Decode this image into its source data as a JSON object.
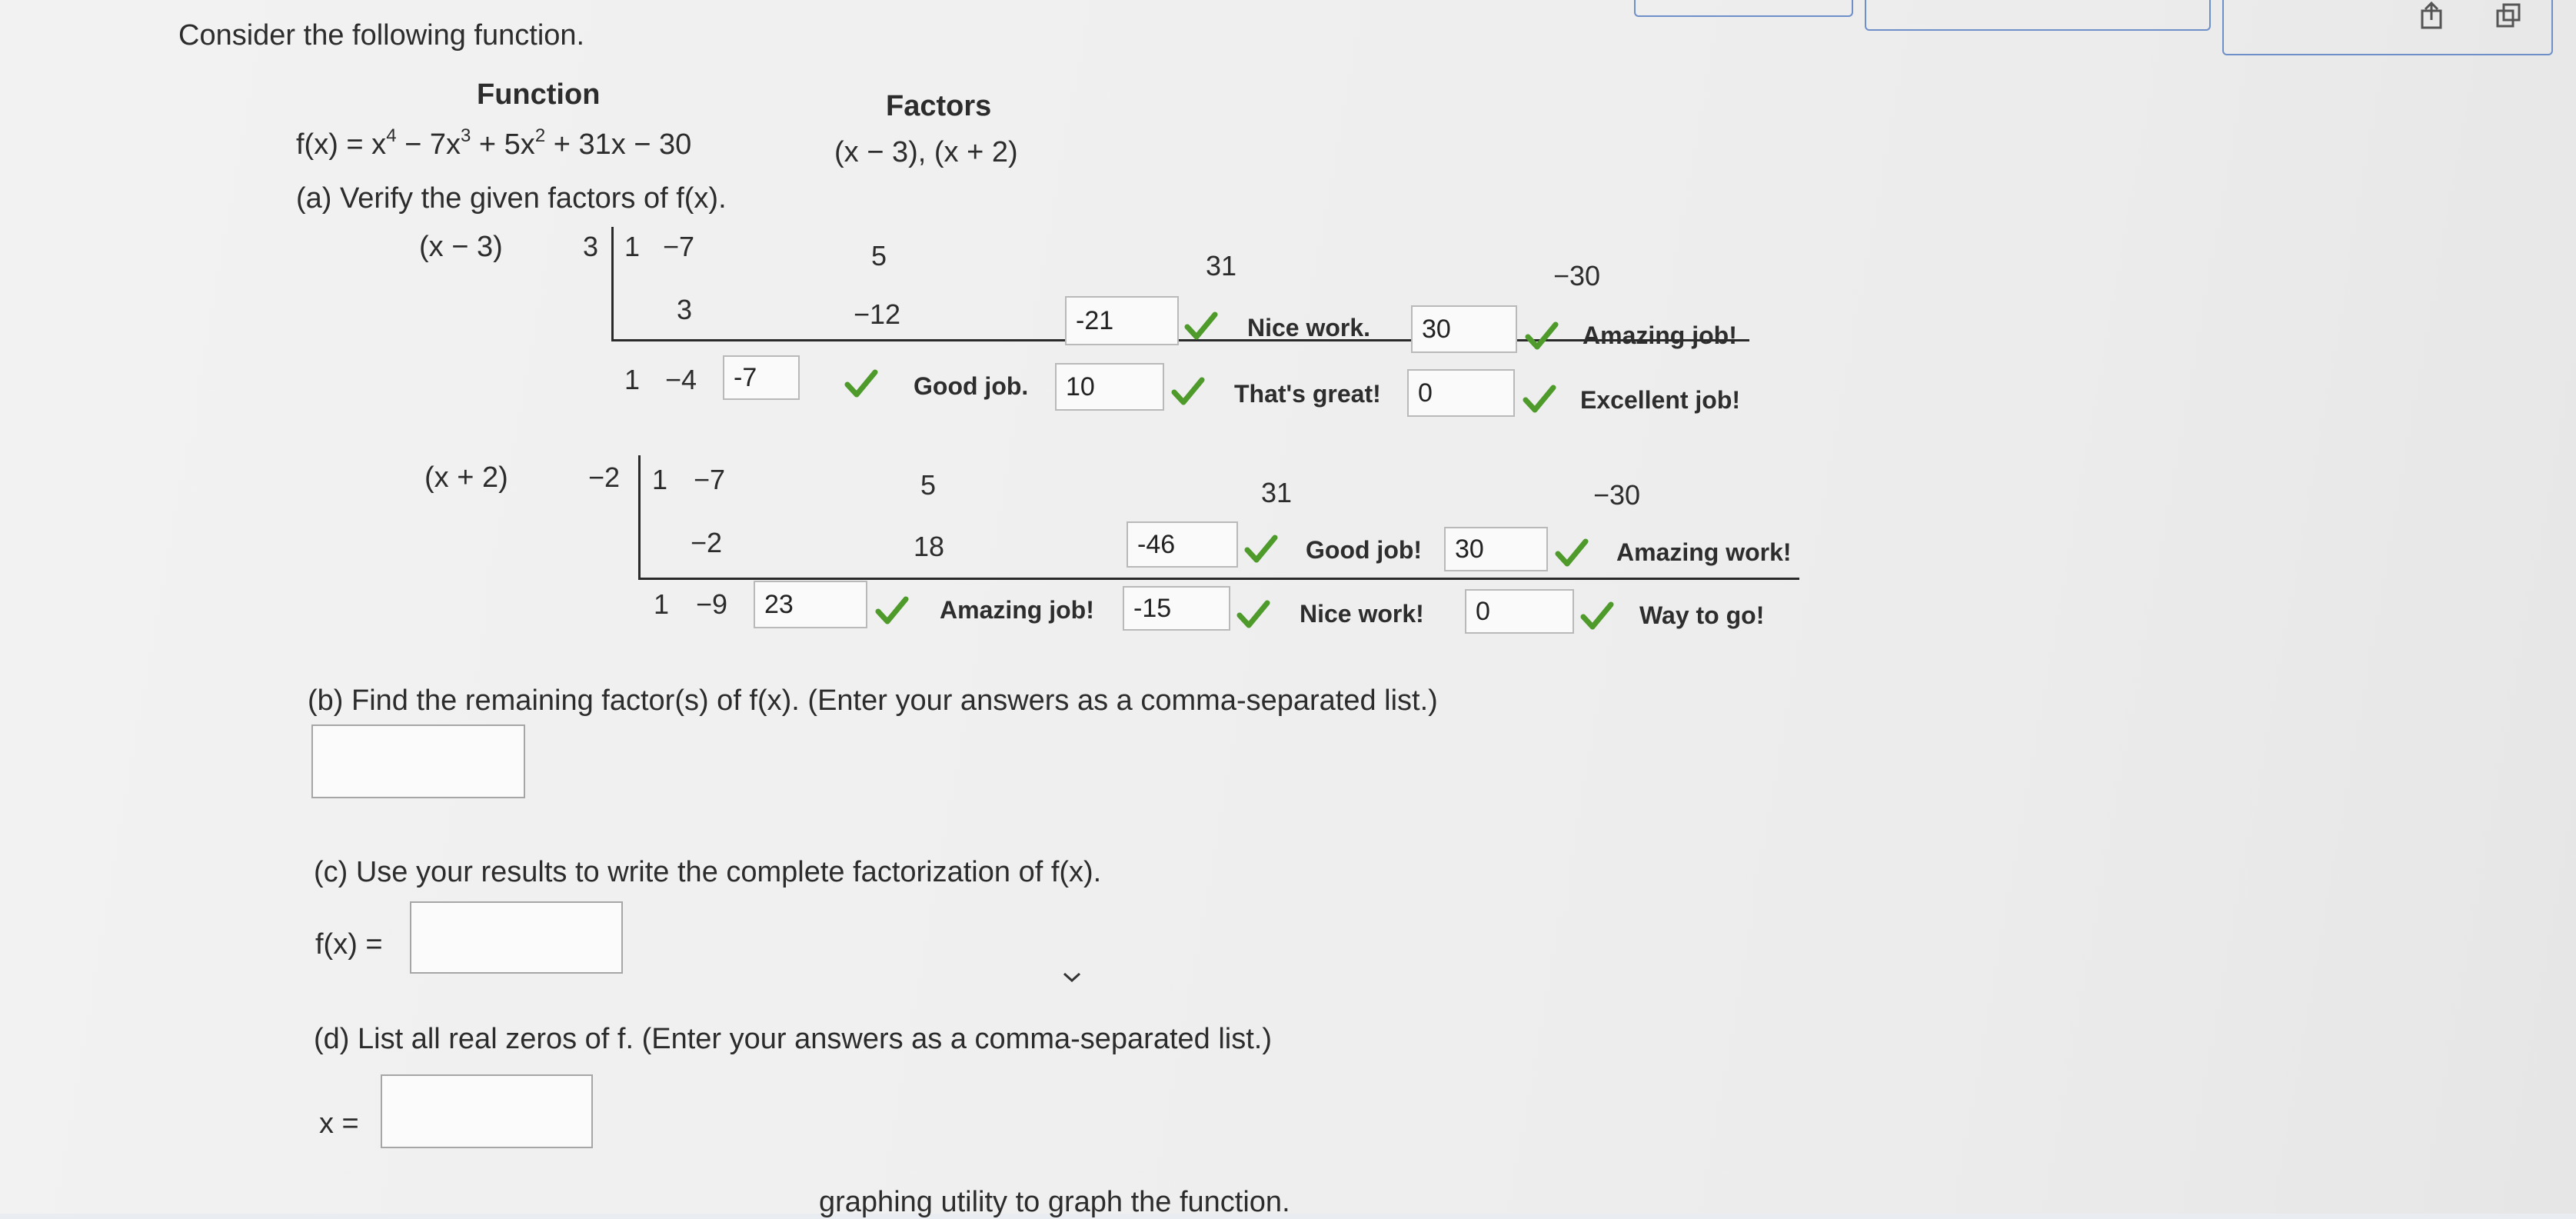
{
  "intro": "Consider the following function.",
  "function_header": "Function",
  "factors_header": "Factors",
  "function_expr": {
    "pre": "f(x) = x",
    "e1": "4",
    "m1": " − 7x",
    "e2": "3",
    "m2": " + 5x",
    "e3": "2",
    "post": " + 31x − 30"
  },
  "factors_expr": "(x − 3), (x + 2)",
  "part_a": "(a) Verify the given factors of f(x).",
  "div1": {
    "label": "(x − 3)",
    "root": "3",
    "top": [
      "1",
      "−7",
      "5",
      "31",
      "−30"
    ],
    "mid": [
      "3",
      "−12",
      "-21",
      "30"
    ],
    "bottom": [
      "1",
      "−4",
      "-7",
      "10",
      "0"
    ],
    "feedback": [
      "Nice work.",
      "Amazing job!",
      "Good job.",
      "That's great!",
      "Excellent job!"
    ]
  },
  "div2": {
    "label": "(x + 2)",
    "root": "−2",
    "top": [
      "1",
      "−7",
      "5",
      "31",
      "−30"
    ],
    "mid": [
      "−2",
      "18",
      "-46",
      "30"
    ],
    "bottom": [
      "1",
      "−9",
      "23",
      "-15",
      "0"
    ],
    "feedback": [
      "Good job!",
      "Amazing work!",
      "Amazing job!",
      "Nice work!",
      "Way to go!"
    ]
  },
  "part_b": "(b) Find the remaining factor(s) of f(x). (Enter your answers as a comma-separated list.)",
  "part_c": "(c) Use your results to write the complete factorization of f(x).",
  "part_c_label": "f(x) =",
  "part_d": "(d) List all real zeros of f. (Enter your answers as a comma-separated list.)",
  "part_d_label": "x =",
  "part_e_partial": "graphing utility to graph the function.",
  "colors": {
    "check": "#4e9a2a",
    "box_border": "#b9b9b9",
    "text": "#2c2c2c"
  }
}
